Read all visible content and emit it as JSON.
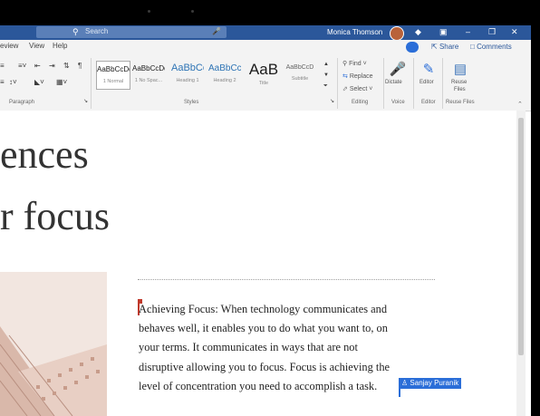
{
  "titlebar": {
    "search_placeholder": "Search",
    "user_name": "Monica Thomson"
  },
  "menu": {
    "items": [
      "eview",
      "View",
      "Help"
    ],
    "share_label": "Share",
    "comments_label": "Comments"
  },
  "ribbon": {
    "paragraph_label": "Paragraph",
    "styles": [
      {
        "preview": "AaBbCcDd",
        "name": "1 Normal"
      },
      {
        "preview": "AaBbCcDd",
        "name": "1 No Spac..."
      },
      {
        "preview": "AaBbCc",
        "name": "Heading 1"
      },
      {
        "preview": "AaBbCcC",
        "name": "Heading 2"
      },
      {
        "preview": "AaB",
        "name": "Title"
      },
      {
        "preview": "AaBbCcD",
        "name": "Subtitle"
      }
    ],
    "styles_label": "Styles",
    "editing": {
      "find": "Find",
      "replace": "Replace",
      "select": "Select",
      "label": "Editing"
    },
    "voice": {
      "dictate": "Dictate",
      "label": "Voice"
    },
    "editor": {
      "button": "Editor",
      "label": "Editor"
    },
    "reuse": {
      "button_line1": "Reuse",
      "button_line2": "Files",
      "label": "Reuse Files"
    }
  },
  "document": {
    "heading_lines": [
      "ences",
      "r focus"
    ],
    "body_lines": [
      "Achieving Focus: When technology communicates and",
      "behaves well, it enables you to do what you want to, on",
      "your terms. It communicates in ways that are not",
      "disruptive allowing you to focus. Focus is achieving the",
      "level of concentration you need to accomplish a task."
    ],
    "collaborator": "Sanjay Puranik"
  },
  "colors": {
    "titlebar": "#2b579a",
    "accent": "#2b6ed8",
    "cursor": "#c0392b"
  }
}
